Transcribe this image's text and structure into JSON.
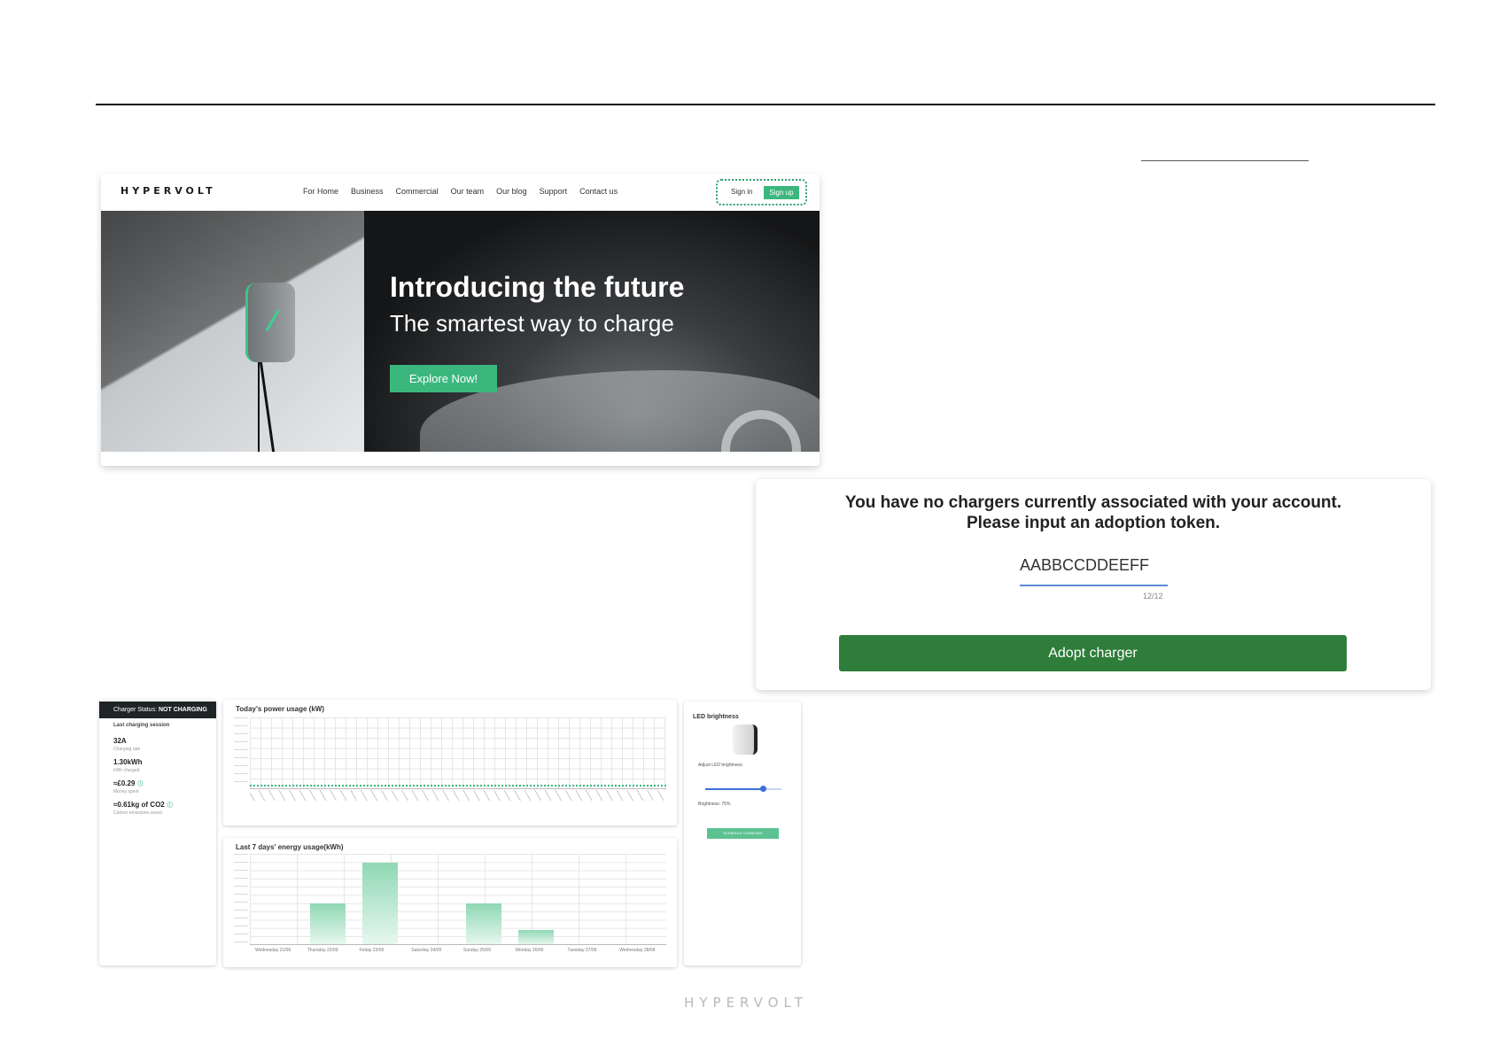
{
  "site": {
    "logo": "HYPERVOLT",
    "nav": [
      "For Home",
      "Business",
      "Commercial",
      "Our team",
      "Our blog",
      "Support",
      "Contact us"
    ],
    "signin": "Sign in",
    "signup": "Sign up",
    "hero_title": "Introducing the future",
    "hero_subtitle": "The smartest way to charge",
    "hero_button": "Explore Now!"
  },
  "adopt": {
    "message_line1": "You have no chargers currently associated with your account.",
    "message_line2": "Please input an adoption token.",
    "token_value": "AABBCCDDEEFF",
    "token_counter": "12/12",
    "button": "Adopt charger"
  },
  "dashboard": {
    "status": {
      "label": "Charger Status: ",
      "value": "NOT CHARGING",
      "session_title": "Last charging session",
      "current": "32A",
      "current_label": "Charging rate",
      "energy": "1.30kWh",
      "energy_label": "kWh charged",
      "cost": "≈£0.29",
      "cost_label": "Money spent",
      "co2": "≈0.61kg of CO2",
      "co2_label": "Carbon emissions saved"
    },
    "power_title": "Today's power usage (kW)",
    "energy_title": "Last 7 days' energy usage(kWh)",
    "led": {
      "title": "LED brightness",
      "adjust_label": "Adjust LED brightness:",
      "brightness_value": 0.75,
      "brightness_text": "Brightness: 75%",
      "schedule_button": "SCHEDULE CHARGING"
    },
    "week_labels": [
      "Wednesday 21/09",
      "Thursday 22/09",
      "Friday 23/09",
      "Saturday 24/09",
      "Sunday 25/09",
      "Monday 26/09",
      "Tuesday 27/09",
      "Wednesday 28/09"
    ]
  },
  "chart_data": {
    "type": "bar",
    "categories": [
      "Wednesday 21/09",
      "Thursday 22/09",
      "Friday 23/09",
      "Saturday 24/09",
      "Sunday 25/09",
      "Monday 26/09",
      "Tuesday 27/09",
      "Wednesday 28/09"
    ],
    "values": [
      0,
      0.45,
      0.9,
      0,
      0.45,
      0.16,
      0,
      0
    ],
    "ylim": [
      0,
      1
    ]
  },
  "footer": {
    "logo": "HYPERVOLT"
  },
  "colors": {
    "accent": "#3bb77e",
    "adopt_button": "#2e7d3a",
    "slider": "#3d6fd8"
  }
}
